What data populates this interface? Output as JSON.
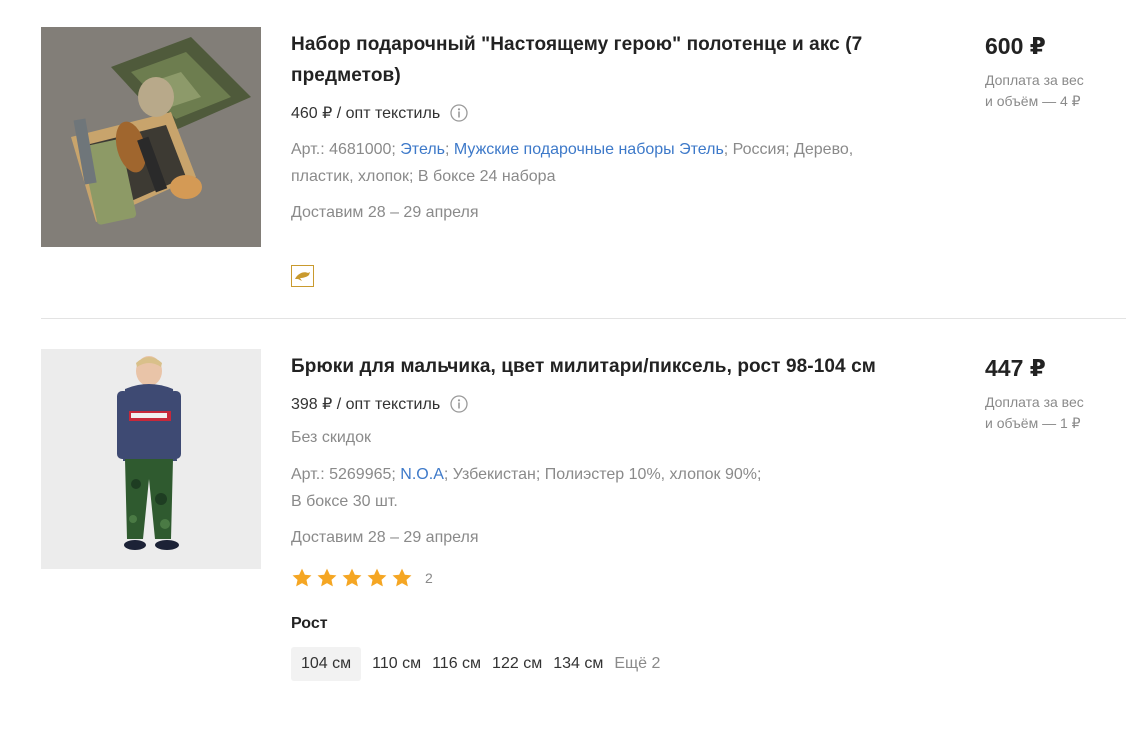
{
  "products": [
    {
      "title": "Набор подарочный \"Настоящему герою\" полотенце и акс (7 предметов)",
      "wholesale_price": "460 ₽ / опт текстиль",
      "meta": {
        "sku": "Арт.: 4681000",
        "brand": "Этель",
        "collection": "Мужские подарочные наборы Этель",
        "country": "Россия",
        "materials": "Дерево, пластик, хлопок",
        "pack": "В боксе 24 набора"
      },
      "delivery": "Доставим 28 – 29 апреля",
      "badge_icon": "dolphin-icon",
      "price": "600 ₽",
      "extra_line1": "Доплата за вес",
      "extra_line2": "и объём — 4 ₽"
    },
    {
      "title": "Брюки для мальчика, цвет милитари/пиксель, рост 98-104 см",
      "wholesale_price": "398 ₽ / опт текстиль",
      "no_discount": "Без скидок",
      "meta": {
        "sku": "Арт.: 5269965",
        "brand": "N.O.A",
        "country": "Узбекистан",
        "materials": "Полиэстер 10%, хлопок 90%",
        "pack": "В боксе 30 шт."
      },
      "delivery": "Доставим 28 – 29 апреля",
      "rating": {
        "stars": 5,
        "count": "2",
        "color": "#f5a623"
      },
      "size_label": "Рост",
      "sizes": [
        "104 см",
        "110 см",
        "116 см",
        "122 см",
        "134 см"
      ],
      "sizes_more": "Ещё 2",
      "price": "447 ₽",
      "extra_line1": "Доплата за вес",
      "extra_line2": "и объём — 1 ₽"
    }
  ],
  "colors": {
    "link": "#3d79c9",
    "muted": "#8a8a8a",
    "star": "#f5a623",
    "badge": "#c99a2e"
  }
}
